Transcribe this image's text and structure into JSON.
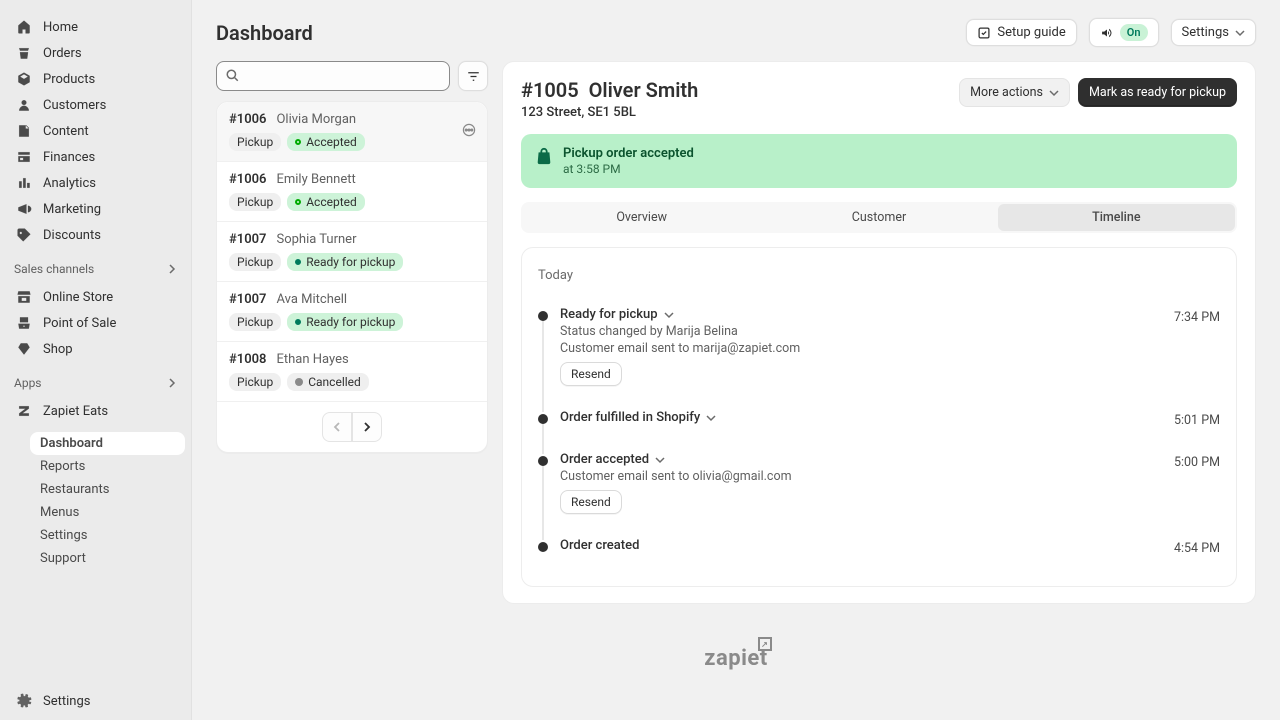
{
  "sidebar": {
    "primary": [
      {
        "icon": "home",
        "label": "Home"
      },
      {
        "icon": "orders",
        "label": "Orders"
      },
      {
        "icon": "products",
        "label": "Products"
      },
      {
        "icon": "customers",
        "label": "Customers"
      },
      {
        "icon": "content",
        "label": "Content"
      },
      {
        "icon": "finances",
        "label": "Finances"
      },
      {
        "icon": "analytics",
        "label": "Analytics"
      },
      {
        "icon": "marketing",
        "label": "Marketing"
      },
      {
        "icon": "discounts",
        "label": "Discounts"
      }
    ],
    "channels_header": "Sales channels",
    "channels": [
      {
        "icon": "store",
        "label": "Online Store"
      },
      {
        "icon": "pos",
        "label": "Point of Sale"
      },
      {
        "icon": "shop",
        "label": "Shop"
      }
    ],
    "apps_header": "Apps",
    "apps": [
      {
        "icon": "zapiet",
        "label": "Zapiet Eats"
      }
    ],
    "app_subnav": [
      {
        "label": "Dashboard",
        "active": true
      },
      {
        "label": "Reports"
      },
      {
        "label": "Restaurants"
      },
      {
        "label": "Menus"
      },
      {
        "label": "Settings"
      },
      {
        "label": "Support"
      }
    ],
    "footer": {
      "icon": "gear",
      "label": "Settings"
    }
  },
  "topbar": {
    "page_title": "Dashboard",
    "setup_guide": "Setup guide",
    "availability_toggle": "On",
    "settings_label": "Settings"
  },
  "search": {
    "placeholder": ""
  },
  "orders": [
    {
      "id": "#1006",
      "customer": "Olivia Morgan",
      "method": "Pickup",
      "status": "Accepted",
      "status_kind": "accepted",
      "selected": true
    },
    {
      "id": "#1006",
      "customer": "Emily Bennett",
      "method": "Pickup",
      "status": "Accepted",
      "status_kind": "accepted"
    },
    {
      "id": "#1007",
      "customer": "Sophia Turner",
      "method": "Pickup",
      "status": "Ready for pickup",
      "status_kind": "ready"
    },
    {
      "id": "#1007",
      "customer": "Ava Mitchell",
      "method": "Pickup",
      "status": "Ready for pickup",
      "status_kind": "ready"
    },
    {
      "id": "#1008",
      "customer": "Ethan Hayes",
      "method": "Pickup",
      "status": "Cancelled",
      "status_kind": "cancelled"
    }
  ],
  "detail": {
    "order_id": "#1005",
    "customer_name": "Oliver Smith",
    "address": "123 Street, SE1 5BL",
    "more_actions_label": "More actions",
    "primary_action_label": "Mark as ready for pickup",
    "banner": {
      "title": "Pickup order accepted",
      "subtitle": "at 3:58 PM"
    },
    "tabs": [
      {
        "label": "Overview"
      },
      {
        "label": "Customer"
      },
      {
        "label": "Timeline",
        "active": true
      }
    ],
    "timeline": {
      "section": "Today",
      "events": [
        {
          "title": "Ready for pickup",
          "expandable": true,
          "meta1": "Status changed by Marija Belina",
          "meta2": "Customer email sent to marija@zapiet.com",
          "resend": "Resend",
          "time": "7:34 PM",
          "completed": true
        },
        {
          "title": "Order fulfilled in Shopify",
          "expandable": true,
          "time": "5:01 PM",
          "completed": true
        },
        {
          "title": "Order accepted",
          "expandable": true,
          "meta2": "Customer email sent to olivia@gmail.com",
          "resend": "Resend",
          "time": "5:00 PM",
          "completed": true
        },
        {
          "title": "Order created",
          "time": "4:54 PM",
          "completed": true
        }
      ]
    }
  },
  "footer_brand": "zapiet"
}
